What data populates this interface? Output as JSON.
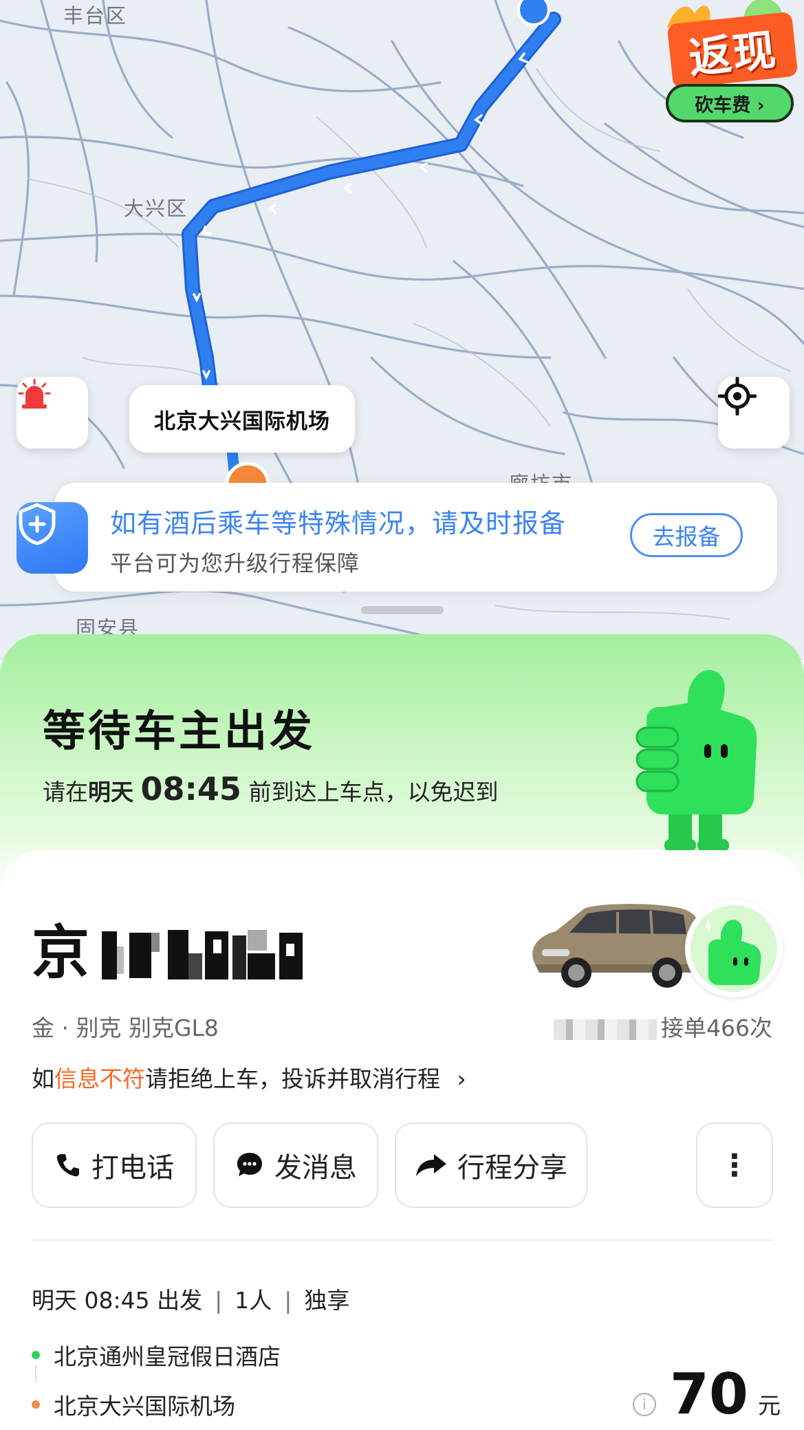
{
  "map": {
    "districts": [
      "丰台区",
      "大兴区",
      "廊坊市",
      "固安县"
    ],
    "destination_bubble": "北京大兴国际机场",
    "route_color": "#2f7ff0"
  },
  "promo": {
    "top": "返现",
    "pill": "砍车费 ›"
  },
  "notice": {
    "title": "如有酒后乘车等特殊情况，请及时报备",
    "subtitle": "平台可为您升级行程保障",
    "button": "去报备"
  },
  "status": {
    "title": "等待车主出发",
    "prefix": "请在",
    "day": "明天",
    "time": "08:45",
    "suffix": "前到达上车点，以免迟到"
  },
  "vehicle": {
    "plate_prefix": "京",
    "info": "金 · 别克 别克GL8",
    "orders": "接单466次"
  },
  "warning": {
    "prefix": "如",
    "highlight": "信息不符",
    "suffix": "请拒绝上车，投诉并取消行程",
    "chevron": "›"
  },
  "actions": {
    "call": "打电话",
    "message": "发消息",
    "share": "行程分享",
    "more": "⋮"
  },
  "trip": {
    "depart": "明天 08:45 出发",
    "sep": "|",
    "passengers": "1人",
    "mode": "独享",
    "from": "北京通州皇冠假日酒店",
    "to": "北京大兴国际机场",
    "from_color": "#2fd35c",
    "to_color": "#f08a4b"
  },
  "price": {
    "amount": "70",
    "unit": "元",
    "info_icon": "i"
  },
  "colors": {
    "accent_blue": "#3b84f3",
    "accent_orange": "#f36a24",
    "mascot_green": "#2ee05a",
    "panel_green": "#a5ef9f"
  }
}
